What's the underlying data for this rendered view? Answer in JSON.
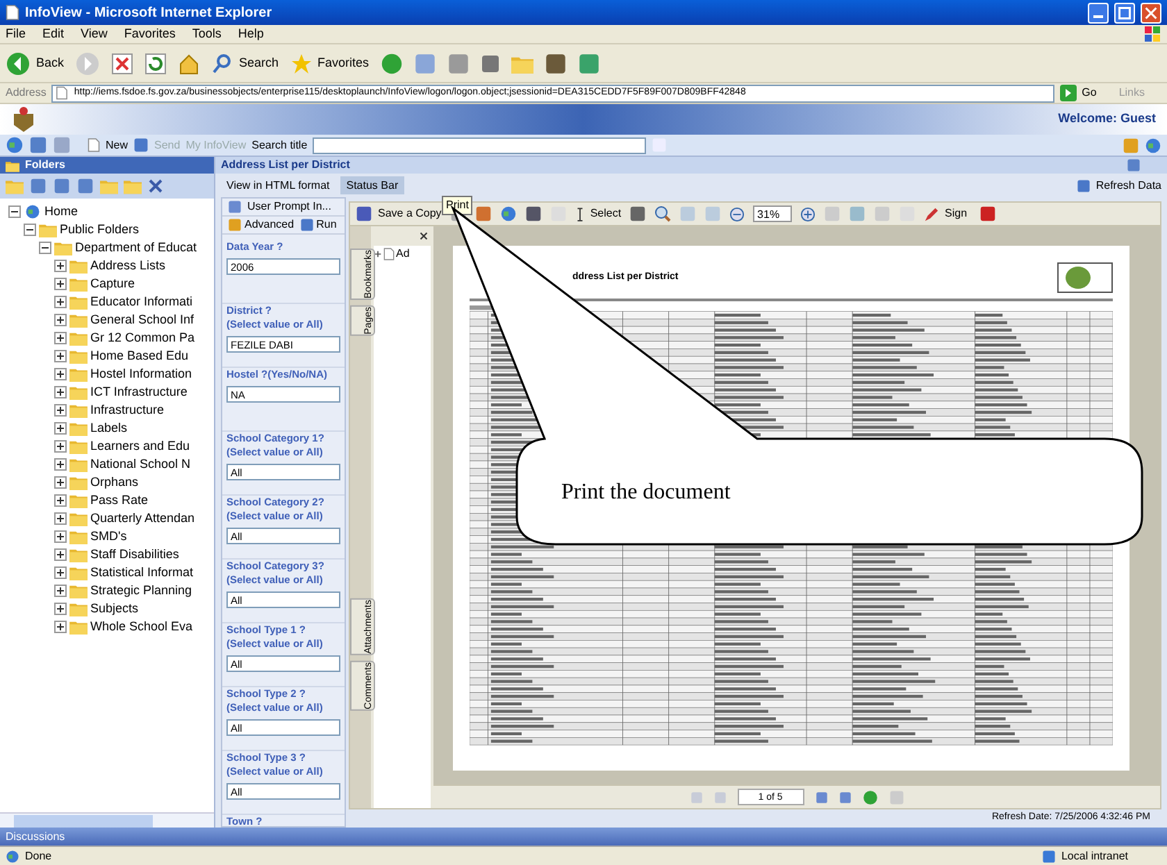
{
  "window": {
    "title": "InfoView - Microsoft Internet Explorer"
  },
  "menu": [
    "File",
    "Edit",
    "View",
    "Favorites",
    "Tools",
    "Help"
  ],
  "ie_toolbar": {
    "back": "Back",
    "search": "Search",
    "favorites": "Favorites"
  },
  "address_bar": {
    "label": "Address",
    "url": "http://iems.fsdoe.fs.gov.za/businessobjects/enterprise115/desktoplaunch/InfoView/logon/logon.object;jsessionid=DEA315CEDD7F5F89F007D809BFF42848",
    "go": "Go",
    "links": "Links"
  },
  "app_header": {
    "welcome": "Welcome: Guest"
  },
  "app_toolbar": {
    "new": "New",
    "send": "Send",
    "my_infoview": "My InfoView",
    "search_label": "Search title"
  },
  "folders": {
    "title": "Folders",
    "tree": [
      {
        "label": "Home",
        "expanded": true,
        "children": [
          {
            "label": "Public Folders",
            "expanded": true,
            "children": [
              {
                "label": "Department of Educat",
                "expanded": true,
                "children": [
                  {
                    "label": "Address Lists",
                    "expanded": false
                  },
                  {
                    "label": "Capture",
                    "expanded": false
                  },
                  {
                    "label": "Educator Informati",
                    "expanded": false
                  },
                  {
                    "label": "General School Inf",
                    "expanded": false
                  },
                  {
                    "label": "Gr 12 Common Pa",
                    "expanded": false
                  },
                  {
                    "label": "Home Based Edu",
                    "expanded": false
                  },
                  {
                    "label": "Hostel Information",
                    "expanded": false
                  },
                  {
                    "label": "ICT Infrastructure",
                    "expanded": false
                  },
                  {
                    "label": "Infrastructure",
                    "expanded": false
                  },
                  {
                    "label": "Labels",
                    "expanded": false
                  },
                  {
                    "label": "Learners and Edu",
                    "expanded": false
                  },
                  {
                    "label": "National School N",
                    "expanded": false
                  },
                  {
                    "label": "Orphans",
                    "expanded": false
                  },
                  {
                    "label": "Pass Rate",
                    "expanded": false
                  },
                  {
                    "label": "Quarterly Attendan",
                    "expanded": false
                  },
                  {
                    "label": "SMD's",
                    "expanded": false
                  },
                  {
                    "label": "Staff Disabilities",
                    "expanded": false
                  },
                  {
                    "label": "Statistical Informat",
                    "expanded": false
                  },
                  {
                    "label": "Strategic Planning",
                    "expanded": false
                  },
                  {
                    "label": "Subjects",
                    "expanded": false
                  },
                  {
                    "label": "Whole School Eva",
                    "expanded": false
                  }
                ]
              }
            ]
          }
        ]
      }
    ]
  },
  "report": {
    "title": "Address List per District",
    "refresh": "Refresh Data",
    "tabs": [
      {
        "label": "View in HTML format",
        "selected": false
      },
      {
        "label": "Status Bar",
        "selected": true
      }
    ],
    "prompts_panel": {
      "header": "User Prompt In...",
      "advanced": "Advanced",
      "run": "Run",
      "prompts": [
        {
          "lines": [
            "Data Year ?"
          ],
          "value": "2006"
        },
        {
          "lines": [
            "District ?",
            "(Select value or All)"
          ],
          "value": "FEZILE DABI"
        },
        {
          "lines": [
            "Hostel ?(Yes/No/NA)"
          ],
          "value": "NA"
        },
        {
          "lines": [
            "School Category 1?",
            "(Select value or All)"
          ],
          "value": "All"
        },
        {
          "lines": [
            "School Category 2?",
            "(Select value or All)"
          ],
          "value": "All"
        },
        {
          "lines": [
            "School Category 3?",
            "(Select value or All)"
          ],
          "value": "All"
        },
        {
          "lines": [
            "School Type 1 ?",
            "(Select value or All)"
          ],
          "value": "All"
        },
        {
          "lines": [
            "School Type 2 ?",
            "(Select value or All)"
          ],
          "value": "All"
        },
        {
          "lines": [
            "School Type 3 ?",
            "(Select value or All)"
          ],
          "value": "All"
        },
        {
          "lines": [
            "Town ?"
          ]
        }
      ]
    },
    "viewer": {
      "save": "Save a Copy",
      "select": "Select",
      "zoom": "31%",
      "sign": "Sign",
      "tooltip": "Print",
      "side_tabs": [
        "Bookmarks",
        "Pages",
        "Attachments",
        "Comments"
      ],
      "bookmark": "Ad",
      "page_title": "ddress List per District",
      "page_nav": "1 of 5"
    },
    "refresh_date": "Refresh Date: 7/25/2006 4:32:46 PM"
  },
  "callout": "Print the document",
  "discussions": "Discussions",
  "status_bar": {
    "text": "Done",
    "zone": "Local intranet"
  }
}
